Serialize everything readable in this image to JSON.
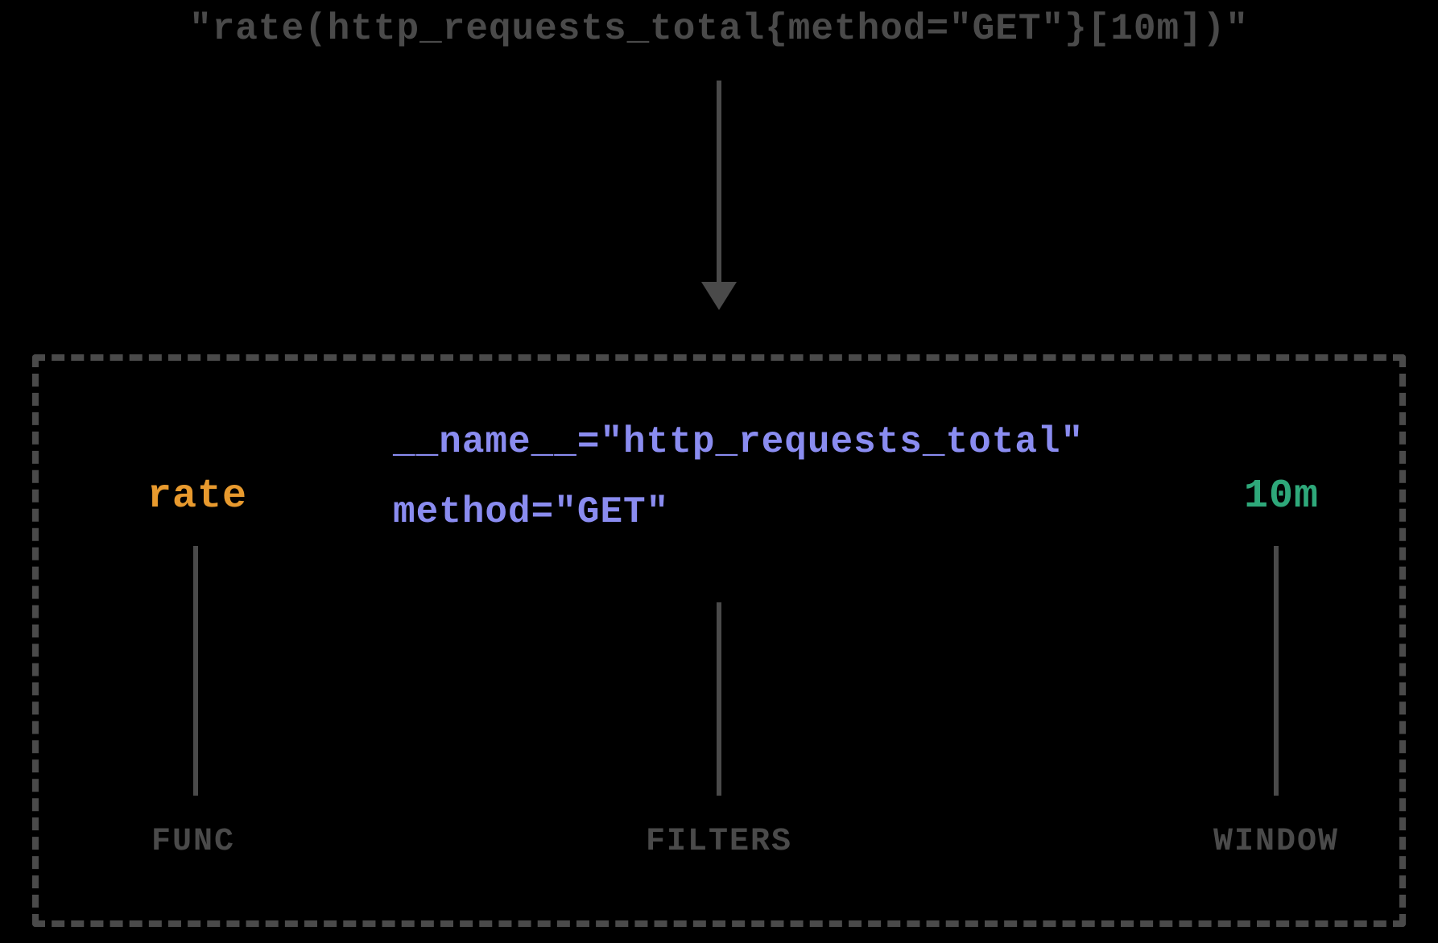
{
  "query": "\"rate(http_requests_total{method=\"GET\"}[10m])\"",
  "breakdown": {
    "func": {
      "value": "rate",
      "label": "FUNC"
    },
    "filters": {
      "lines": [
        "__name__=\"http_requests_total\"",
        "method=\"GET\""
      ],
      "label": "FILTERS"
    },
    "window": {
      "value": "10m",
      "label": "WINDOW"
    }
  }
}
